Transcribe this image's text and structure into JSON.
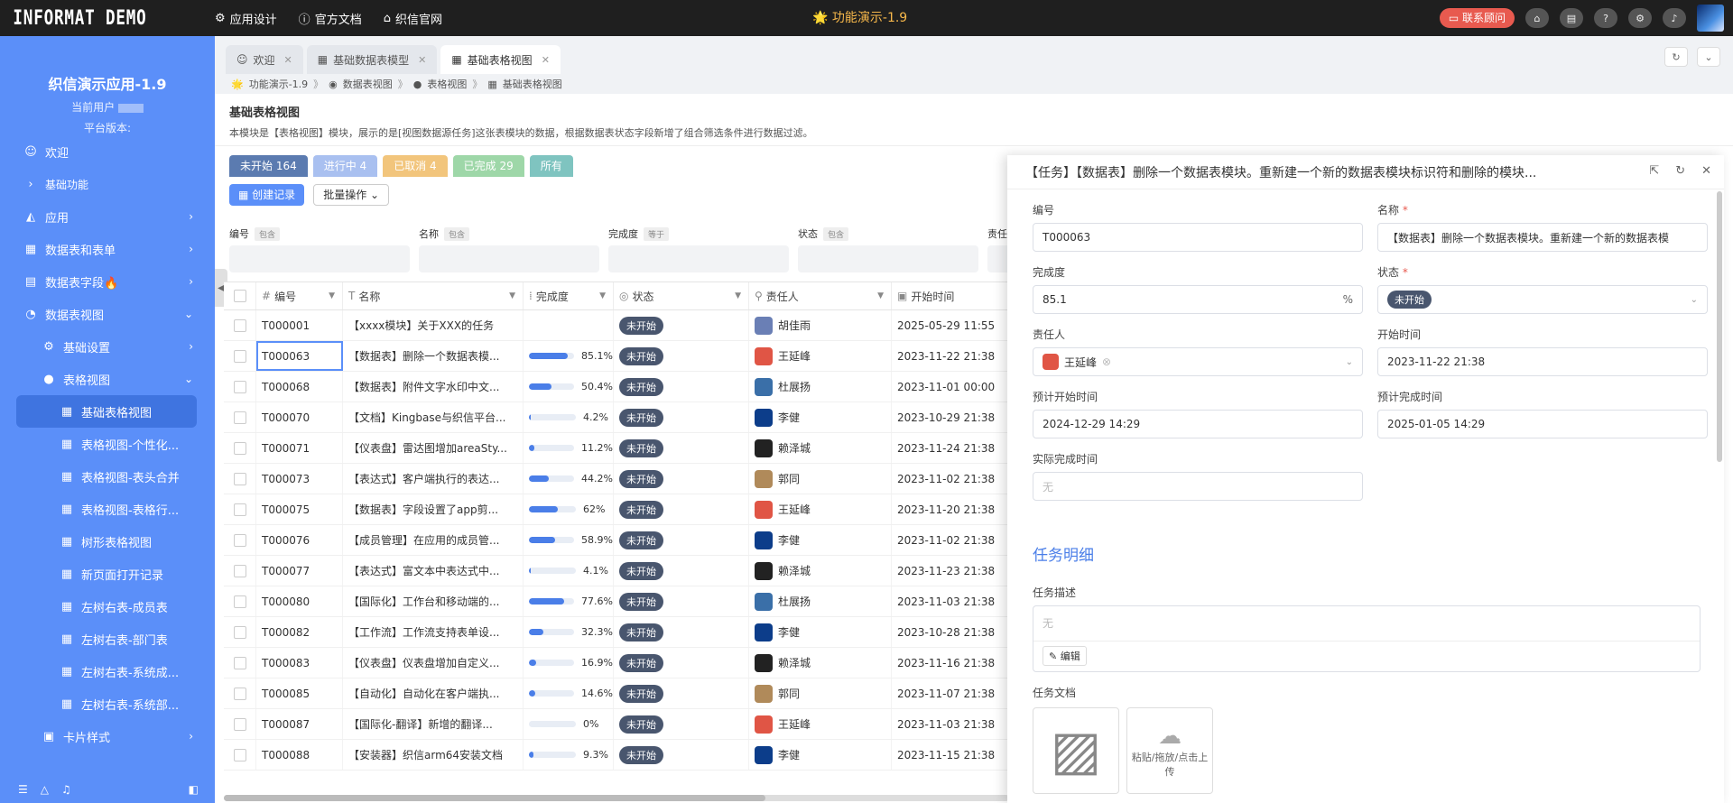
{
  "topbar": {
    "logo": "INFORMAT DEMO",
    "nav": [
      "应用设计",
      "官方文档",
      "织信官网"
    ],
    "center_title": "功能演示-1.9",
    "contact_label": "联系顾问",
    "accent_color": "#e85a4f"
  },
  "sidebar": {
    "app_name": "织信演示应用-1.9",
    "current_user_label": "当前用户",
    "platform_version_label": "平台版本:",
    "items": [
      {
        "label": "欢迎",
        "level": 1,
        "icon": "smile-icon"
      },
      {
        "label": "基础功能",
        "level": 1,
        "icon": "chevron-right-icon"
      },
      {
        "label": "应用",
        "level": 1,
        "icon": "app-icon"
      },
      {
        "label": "数据表和表单",
        "level": 1,
        "icon": "table-icon"
      },
      {
        "label": "数据表字段🔥",
        "level": 1,
        "icon": "fields-icon"
      },
      {
        "label": "数据表视图",
        "level": 1,
        "icon": "view-icon"
      },
      {
        "label": "基础设置",
        "level": 2,
        "icon": "gear-icon"
      },
      {
        "label": "表格视图",
        "level": 2,
        "icon": "dot-icon"
      },
      {
        "label": "基础表格视图",
        "level": 3,
        "icon": "grid-icon"
      },
      {
        "label": "表格视图-个性化...",
        "level": 3,
        "icon": "grid-icon"
      },
      {
        "label": "表格视图-表头合并",
        "level": 3,
        "icon": "grid-icon"
      },
      {
        "label": "表格视图-表格行...",
        "level": 3,
        "icon": "grid-icon"
      },
      {
        "label": "树形表格视图",
        "level": 3,
        "icon": "grid-icon"
      },
      {
        "label": "新页面打开记录",
        "level": 3,
        "icon": "grid-icon"
      },
      {
        "label": "左树右表-成员表",
        "level": 3,
        "icon": "grid-icon"
      },
      {
        "label": "左树右表-部门表",
        "level": 3,
        "icon": "grid-icon"
      },
      {
        "label": "左树右表-系统成...",
        "level": 3,
        "icon": "grid-icon"
      },
      {
        "label": "左树右表-系统部...",
        "level": 3,
        "icon": "grid-icon"
      },
      {
        "label": "卡片样式",
        "level": 2,
        "icon": "card-icon"
      }
    ]
  },
  "tabs": [
    {
      "label": "欢迎"
    },
    {
      "label": "基础数据表模型"
    },
    {
      "label": "基础表格视图"
    }
  ],
  "breadcrumb": [
    "功能演示-1.9",
    "数据表视图",
    "表格视图",
    "基础表格视图"
  ],
  "page": {
    "title": "基础表格视图",
    "description": "本模块是【表格视图】模块，展示的是[视图数据源任务]这张表模块的数据，根据数据表状态字段新增了组合筛选条件进行数据过滤。"
  },
  "filters": [
    {
      "label": "未开始 164",
      "color": "#5b7bb0"
    },
    {
      "label": "进行中 4",
      "color": "#a9c0f0"
    },
    {
      "label": "已取消 4",
      "color": "#f2c57c"
    },
    {
      "label": "已完成 29",
      "color": "#9ed7a8"
    },
    {
      "label": "所有",
      "color": "#7fc4c0"
    }
  ],
  "toolbar": {
    "create_label": "创建记录",
    "batch_label": "批量操作"
  },
  "search_fields": [
    {
      "label": "编号",
      "op": "包含"
    },
    {
      "label": "名称",
      "op": "包含"
    },
    {
      "label": "完成度",
      "op": "等于"
    },
    {
      "label": "状态",
      "op": "包含"
    },
    {
      "label": "责任",
      "op": ""
    }
  ],
  "table": {
    "columns": [
      "编号",
      "名称",
      "完成度",
      "状态",
      "责任人",
      "开始时间"
    ],
    "rows": [
      {
        "id": "T000001",
        "name": "【xxxx模块】关于XXX的任务",
        "pct": "",
        "pct_value": 0,
        "status": "未开始",
        "owner": "胡佳雨",
        "owner_color": "#6a7fb5",
        "start": "2025-05-29 11:55"
      },
      {
        "id": "T000063",
        "name": "【数据表】删除一个数据表模...",
        "pct": "85.1%",
        "pct_value": 85.1,
        "status": "未开始",
        "owner": "王延峰",
        "owner_color": "#e05545",
        "start": "2023-11-22 21:38"
      },
      {
        "id": "T000068",
        "name": "【数据表】附件文字水印中文...",
        "pct": "50.4%",
        "pct_value": 50.4,
        "status": "未开始",
        "owner": "杜展扬",
        "owner_color": "#3a6fa8",
        "start": "2023-11-01 00:00"
      },
      {
        "id": "T000070",
        "name": "【文档】Kingbase与织信平台...",
        "pct": "4.2%",
        "pct_value": 4.2,
        "status": "未开始",
        "owner": "李健",
        "owner_color": "#0c3d8a",
        "start": "2023-10-29 21:38"
      },
      {
        "id": "T000071",
        "name": "【仪表盘】雷达图增加areaSty...",
        "pct": "11.2%",
        "pct_value": 11.2,
        "status": "未开始",
        "owner": "赖泽城",
        "owner_color": "#222222",
        "start": "2023-11-24 21:38"
      },
      {
        "id": "T000073",
        "name": "【表达式】客户端执行的表达...",
        "pct": "44.2%",
        "pct_value": 44.2,
        "status": "未开始",
        "owner": "郭同",
        "owner_color": "#b08a5a",
        "start": "2023-11-02 21:38"
      },
      {
        "id": "T000075",
        "name": "【数据表】字段设置了app剪...",
        "pct": "62%",
        "pct_value": 62,
        "status": "未开始",
        "owner": "王延峰",
        "owner_color": "#e05545",
        "start": "2023-11-20 21:38"
      },
      {
        "id": "T000076",
        "name": "【成员管理】在应用的成员管...",
        "pct": "58.9%",
        "pct_value": 58.9,
        "status": "未开始",
        "owner": "李健",
        "owner_color": "#0c3d8a",
        "start": "2023-11-02 21:38"
      },
      {
        "id": "T000077",
        "name": "【表达式】富文本中表达式中...",
        "pct": "4.1%",
        "pct_value": 4.1,
        "status": "未开始",
        "owner": "赖泽城",
        "owner_color": "#222222",
        "start": "2023-11-23 21:38"
      },
      {
        "id": "T000080",
        "name": "【国际化】工作台和移动端的...",
        "pct": "77.6%",
        "pct_value": 77.6,
        "status": "未开始",
        "owner": "杜展扬",
        "owner_color": "#3a6fa8",
        "start": "2023-11-03 21:38"
      },
      {
        "id": "T000082",
        "name": "【工作流】工作流支持表单设...",
        "pct": "32.3%",
        "pct_value": 32.3,
        "status": "未开始",
        "owner": "李健",
        "owner_color": "#0c3d8a",
        "start": "2023-10-28 21:38"
      },
      {
        "id": "T000083",
        "name": "【仪表盘】仪表盘增加自定义...",
        "pct": "16.9%",
        "pct_value": 16.9,
        "status": "未开始",
        "owner": "赖泽城",
        "owner_color": "#222222",
        "start": "2023-11-16 21:38"
      },
      {
        "id": "T000085",
        "name": "【自动化】自动化在客户端执...",
        "pct": "14.6%",
        "pct_value": 14.6,
        "status": "未开始",
        "owner": "郭同",
        "owner_color": "#b08a5a",
        "start": "2023-11-07 21:38"
      },
      {
        "id": "T000087",
        "name": "【国际化-翻译】新增的翻译...",
        "pct": "0%",
        "pct_value": 0,
        "status": "未开始",
        "owner": "王延峰",
        "owner_color": "#e05545",
        "start": "2023-11-03 21:38"
      },
      {
        "id": "T000088",
        "name": "【安装器】织信arm64安装文档",
        "pct": "9.3%",
        "pct_value": 9.3,
        "status": "未开始",
        "owner": "李健",
        "owner_color": "#0c3d8a",
        "start": "2023-11-15 21:38"
      }
    ]
  },
  "drawer": {
    "title": "【任务】【数据表】删除一个数据表模块。重新建一个新的数据表模块标识符和删除的模块...",
    "fields": {
      "id_label": "编号",
      "id_value": "T000063",
      "name_label": "名称",
      "name_value": "【数据表】删除一个数据表模块。重新建一个新的数据表模",
      "pct_label": "完成度",
      "pct_value": "85.1",
      "pct_suffix": "%",
      "status_label": "状态",
      "status_value": "未开始",
      "owner_label": "责任人",
      "owner_value": "王延峰",
      "start_label": "开始时间",
      "start_value": "2023-11-22 21:38",
      "plan_start_label": "预计开始时间",
      "plan_start_value": "2024-12-29 14:29",
      "plan_end_label": "预计完成时间",
      "plan_end_value": "2025-01-05 14:29",
      "actual_end_label": "实际完成时间",
      "actual_end_placeholder": "无"
    },
    "section_title": "任务明细",
    "desc_label": "任务描述",
    "desc_placeholder": "无",
    "edit_label": "编辑",
    "docs_label": "任务文档",
    "upload_text": "粘贴/拖放/点击上传"
  }
}
